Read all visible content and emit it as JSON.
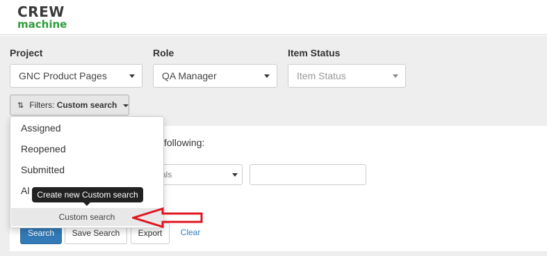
{
  "brand": {
    "top": "CREW",
    "bottom": "machine"
  },
  "fields": {
    "project": {
      "label": "Project",
      "value": "GNC Product Pages"
    },
    "role": {
      "label": "Role",
      "value": "QA Manager"
    },
    "item_status": {
      "label": "Item Status",
      "placeholder": "Item Status"
    }
  },
  "filters_button": {
    "prefix": "Filters:",
    "value": "Custom search"
  },
  "panel": {
    "match_text": "following:",
    "operator_value": "als"
  },
  "dropdown": {
    "items": [
      {
        "label": "Assigned"
      },
      {
        "label": "Reopened"
      },
      {
        "label": "Submitted"
      },
      {
        "label": "Al"
      }
    ],
    "custom_item": "Custom search"
  },
  "tooltip": "Create new Custom search",
  "actions": {
    "search": "Search",
    "save_search": "Save Search",
    "export": "Export",
    "clear": "Clear"
  },
  "colors": {
    "brand_green": "#2e9c3c",
    "primary": "#337ab7",
    "annotation_red": "#e0141e"
  }
}
